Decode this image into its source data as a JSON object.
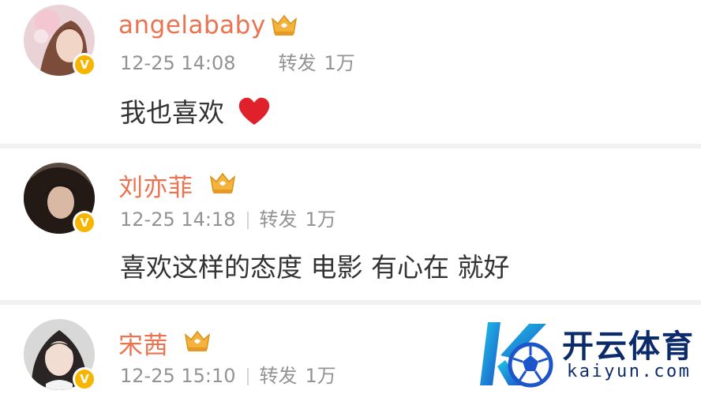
{
  "posts": [
    {
      "username": "angelababy",
      "time": "12-25 14:08",
      "repost_label": "转发",
      "repost_count": "1万",
      "content": "我也喜欢"
    },
    {
      "username": "刘亦菲",
      "time": "12-25 14:18",
      "repost_label": "转发",
      "repost_count": "1万",
      "content": "喜欢这样的态度 电影 有心在 就好"
    },
    {
      "username": "宋茜",
      "time": "12-25 15:10",
      "repost_label": "转发",
      "repost_count": "1万",
      "content": ""
    }
  ],
  "watermark": {
    "name_cn": "开云体育",
    "name_en": "kaiyun.com"
  },
  "colors": {
    "username": "#eb7350",
    "meta": "#939393",
    "verified": "#f7b500",
    "heart": "#e0212b",
    "logo_navy": "#0c2b6b",
    "logo_cyan": "#1fc7e8"
  },
  "icons": [
    "verified-badge-icon",
    "vip-crown-icon",
    "heart-icon",
    "kaiyun-logo"
  ]
}
